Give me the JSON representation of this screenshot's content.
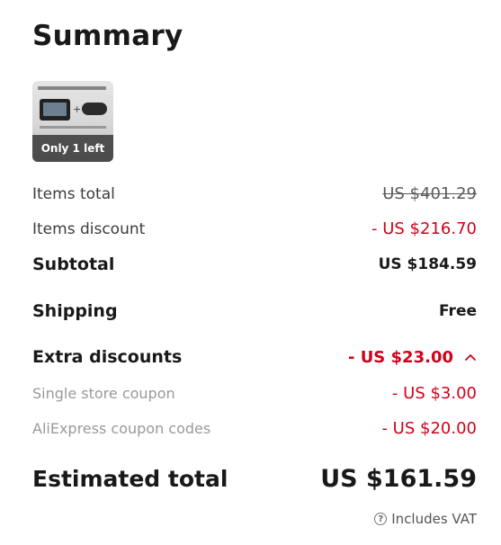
{
  "summary": {
    "title": "Summary",
    "product": {
      "stock_badge": "Only 1 left"
    },
    "items_total": {
      "label": "Items total",
      "value": "US $401.29"
    },
    "items_discount": {
      "label": "Items discount",
      "value": "- US $216.70"
    },
    "subtotal": {
      "label": "Subtotal",
      "value": "US $184.59"
    },
    "shipping": {
      "label": "Shipping",
      "value": "Free"
    },
    "extra_discounts": {
      "label": "Extra discounts",
      "value": "- US $23.00",
      "expanded": true
    },
    "store_coupon": {
      "label": "Single store coupon",
      "value": "- US $3.00"
    },
    "aliexpress_coupon": {
      "label": "AliExpress coupon codes",
      "value": "- US $20.00"
    },
    "estimated_total": {
      "label": "Estimated total",
      "value": "US $161.59"
    },
    "vat_note": "Includes VAT"
  },
  "colors": {
    "discount_red": "#d0021b",
    "text_dark": "#191919",
    "text_muted": "#999999"
  },
  "icons": {
    "expand": "chevron-up-icon",
    "help": "question-circle-icon"
  }
}
